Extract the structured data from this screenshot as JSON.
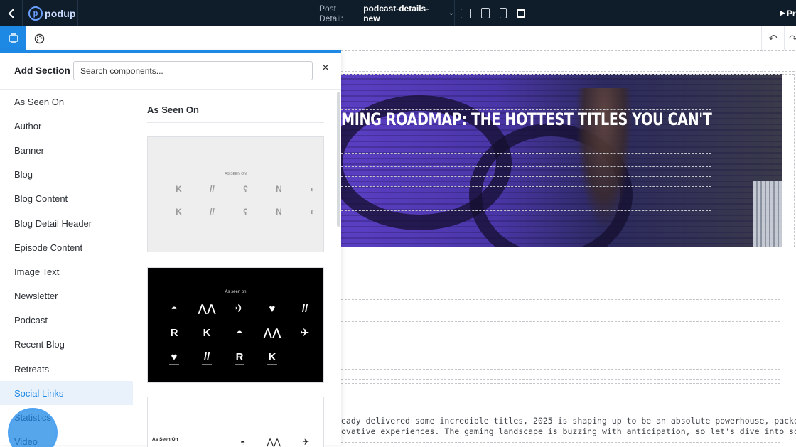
{
  "topbar": {
    "logo_text": "podup",
    "post_detail_label": "Post Detail:",
    "post_detail_value": "podcast-details-new",
    "preview_label": "Pr",
    "devices": [
      "desktop-icon",
      "tablet-icon",
      "phone-icon",
      "fullscreen-icon"
    ]
  },
  "subbar": {
    "tools": [
      "sections-icon",
      "palette-icon"
    ],
    "actions": [
      "undo-icon",
      "redo-icon"
    ]
  },
  "panel": {
    "title": "Add Section",
    "search_placeholder": "Search components...",
    "items": [
      {
        "label": "As Seen On"
      },
      {
        "label": "Author"
      },
      {
        "label": "Banner"
      },
      {
        "label": "Blog"
      },
      {
        "label": "Blog Content"
      },
      {
        "label": "Blog Detail Header"
      },
      {
        "label": "Episode Content"
      },
      {
        "label": "Image Text"
      },
      {
        "label": "Newsletter"
      },
      {
        "label": "Podcast"
      },
      {
        "label": "Recent Blog"
      },
      {
        "label": "Retreats"
      },
      {
        "label": "Social Links"
      },
      {
        "label": "Statistics"
      },
      {
        "label": "Video"
      }
    ],
    "hovered_item": "Social Links",
    "content_title": "As Seen On",
    "card1_label": "AS SEEN ON",
    "card2_label": "As seen on",
    "card3_title": "As Seen On"
  },
  "canvas": {
    "hero_title": "MING ROADMAP: THE HOTTEST TITLES YOU CAN'T",
    "body_line1": "eady delivered some incredible titles, 2025 is shaping up to be an absolute powerhouse, packed with a perfect",
    "body_line2": "ovative experiences. The gaming landscape is buzzing with anticipation, so let's dive into some of the hottest"
  },
  "colors": {
    "topbar_bg": "#0f1d2b",
    "accent": "#1e88e5",
    "hover_bg": "#e9f2fb",
    "hero_purple": "#5b3fc4"
  }
}
